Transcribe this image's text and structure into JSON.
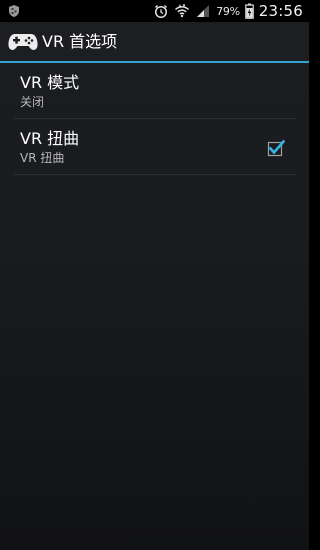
{
  "status_bar": {
    "left_icon": "shield-icon",
    "icons": [
      "alarm-clock-icon",
      "wifi-icon",
      "cell-signal-icon"
    ],
    "battery_percent": "79%",
    "battery_icon": "battery-charging-icon",
    "time": "23:56"
  },
  "action_bar": {
    "icon": "gamepad-icon",
    "title": "VR 首选项",
    "accent_color": "#33a3cf"
  },
  "preferences": [
    {
      "title": "VR 模式",
      "summary": "关闭",
      "has_checkbox": false
    },
    {
      "title": "VR 扭曲",
      "summary": "VR 扭曲",
      "has_checkbox": true,
      "checked": true
    }
  ]
}
